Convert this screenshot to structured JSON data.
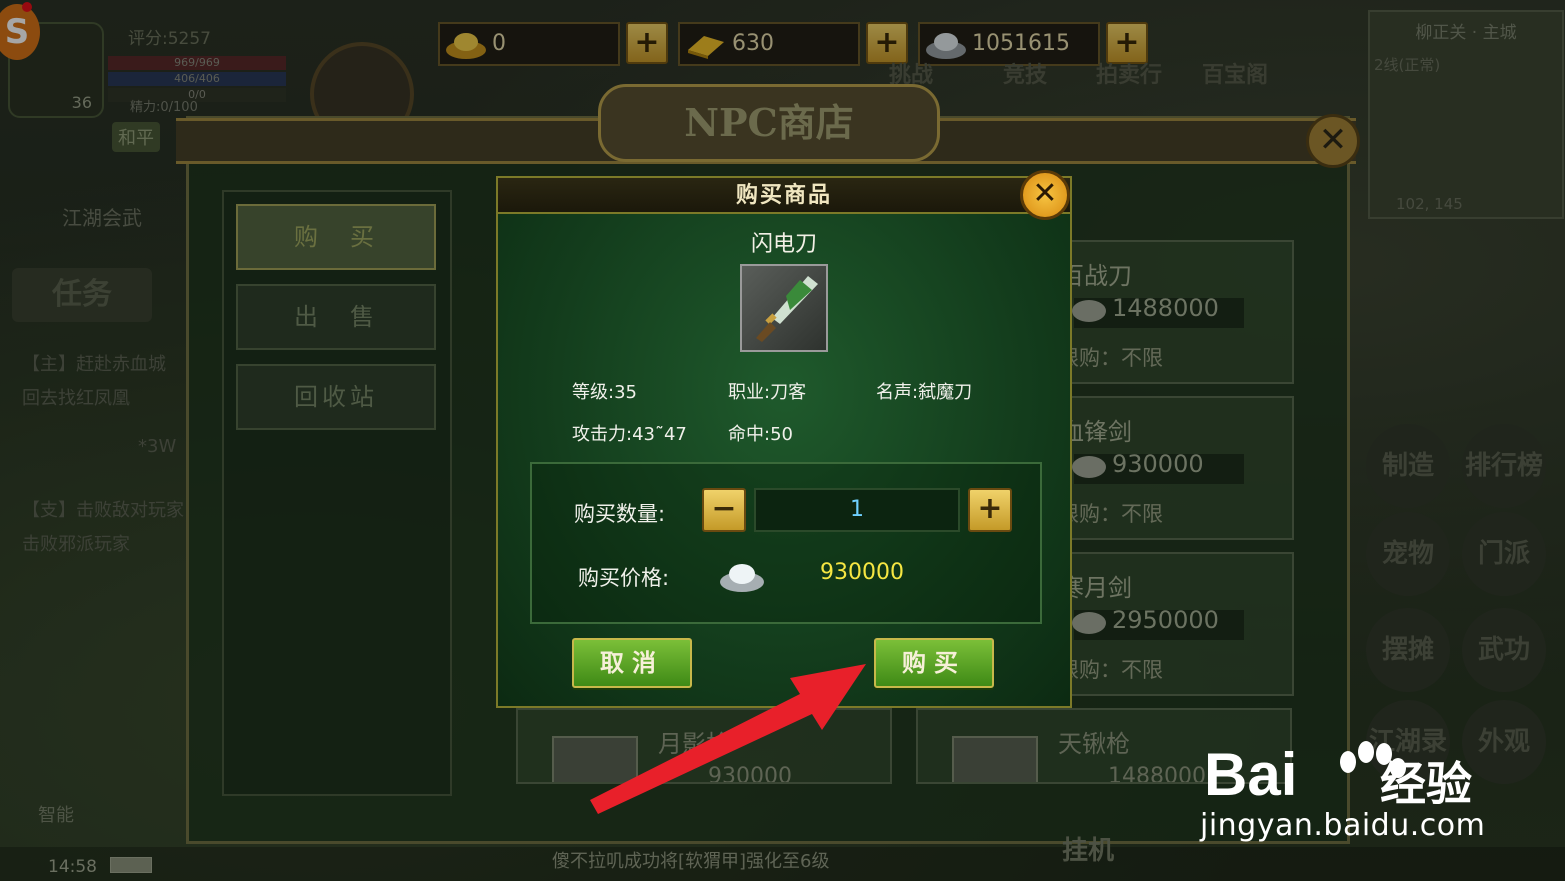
{
  "hud": {
    "score": "评分:5257",
    "hp": "969/969",
    "mp": "406/406",
    "exp": "0/0",
    "energy": "精力:0/100",
    "level": "36",
    "mode": "和平"
  },
  "currency": {
    "gold": "0",
    "ingot": "630",
    "silver": "1051615"
  },
  "top_icons": [
    "挑战",
    "竞技",
    "拍卖行",
    "百宝阁"
  ],
  "minimap": {
    "location": "柳正关 · 主城",
    "line": "2线(正常)",
    "coords": "102, 145"
  },
  "right_menu": [
    "制造",
    "排行榜",
    "宠物",
    "门派",
    "摆摊",
    "武功",
    "江湖录",
    "外观"
  ],
  "left_panel": {
    "league": "江湖会武",
    "task_tab": "任务",
    "quests": [
      "【主】赶赴赤血城",
      "回去找红凤凰",
      "【支】击败敌对玩家",
      "击败邪派玩家"
    ],
    "reward": "*3W"
  },
  "shop": {
    "title": "NPC商店",
    "tabs": [
      "购　买",
      "出　售",
      "回收站"
    ],
    "cards": [
      {
        "name": "百战刀",
        "price": "1488000",
        "limit": "限购：不限"
      },
      {
        "name": "血锋剑",
        "price": "930000",
        "limit": "限购：不限"
      },
      {
        "name": "寒月剑",
        "price": "2950000",
        "limit": "限购：不限"
      }
    ],
    "bottom_cards": [
      {
        "name": "月影枪",
        "price": "930000"
      },
      {
        "name": "天锹枪",
        "price": "1488000"
      }
    ]
  },
  "dialog": {
    "title": "购买商品",
    "item_name": "闪电刀",
    "level": "等级:35",
    "class": "职业:刀客",
    "fame": "名声:弑魔刀",
    "attack": "攻击力:43˜47",
    "hit": "命中:50",
    "qty_label": "购买数量:",
    "qty": "1",
    "price_label": "购买价格:",
    "price": "930000",
    "cancel": "取消",
    "buy": "购买"
  },
  "bottom": {
    "time": "14:58",
    "news": "傻不拉叽成功将[软猬甲]强化至6级",
    "hangup": "挂机",
    "auto": "智能"
  },
  "watermark": {
    "brand": "Bai",
    "cn": "经验",
    "url": "jingyan.baidu.com"
  },
  "colors": {
    "arrow": "#e8202a",
    "price_yellow": "#f6e642",
    "button_green": "#4f9a20"
  }
}
